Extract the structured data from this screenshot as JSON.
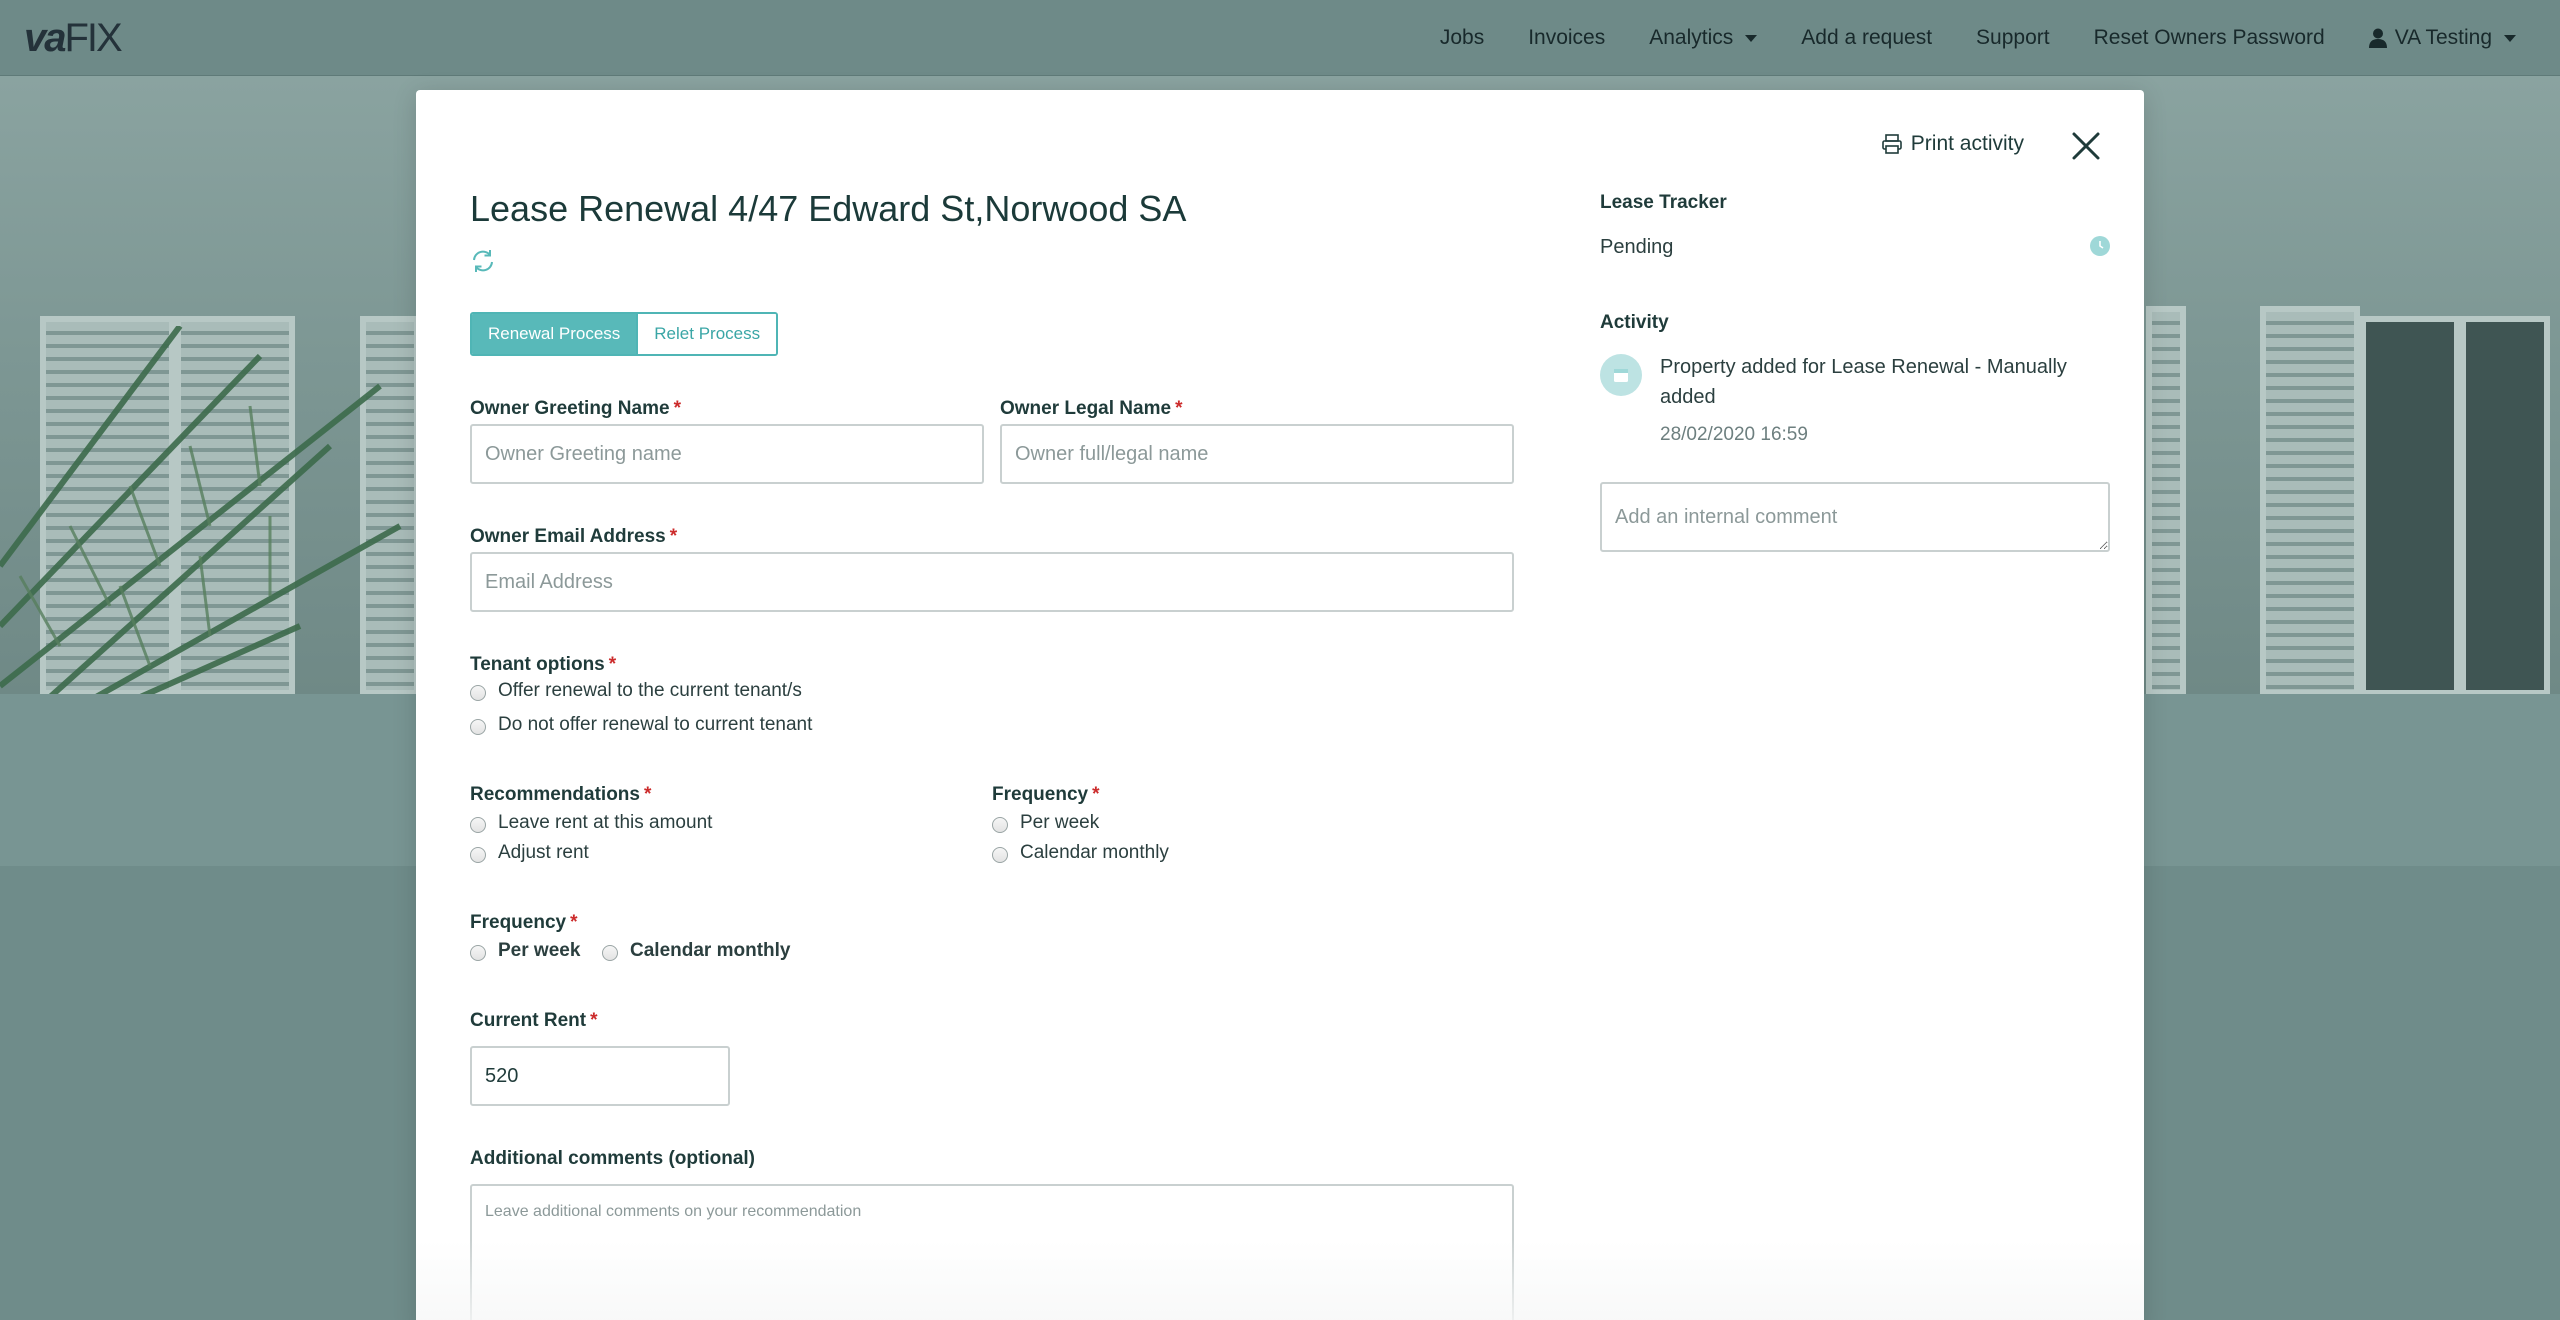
{
  "navbar": {
    "logo_va": "va",
    "logo_fix": "FIX",
    "items": [
      {
        "label": "Jobs"
      },
      {
        "label": "Invoices"
      },
      {
        "label": "Analytics"
      },
      {
        "label": "Add a request"
      },
      {
        "label": "Support"
      },
      {
        "label": "Reset Owners Password"
      },
      {
        "label": "VA Testing"
      }
    ]
  },
  "modal": {
    "print_label": "Print activity",
    "title": "Lease Renewal 4/47 Edward St,Norwood SA",
    "tabs": [
      {
        "label": "Renewal Process",
        "active": true
      },
      {
        "label": "Relet Process",
        "active": false
      }
    ],
    "form": {
      "owner_greeting": {
        "label": "Owner Greeting Name",
        "placeholder": "Owner Greeting name",
        "value": ""
      },
      "owner_legal": {
        "label": "Owner Legal Name",
        "placeholder": "Owner full/legal name",
        "value": ""
      },
      "owner_email": {
        "label": "Owner Email Address",
        "placeholder": "Email Address",
        "value": ""
      },
      "tenant_options": {
        "label": "Tenant options",
        "options": [
          "Offer renewal to the current tenant/s",
          "Do not offer renewal to current tenant"
        ]
      },
      "recommendations": {
        "label": "Recommendations",
        "options": [
          "Leave rent at this amount",
          "Adjust rent"
        ]
      },
      "frequency_right": {
        "label": "Frequency",
        "options": [
          "Per week",
          "Calendar monthly"
        ]
      },
      "frequency": {
        "label": "Frequency",
        "options": [
          "Per week",
          "Calendar monthly"
        ]
      },
      "current_rent": {
        "label": "Current Rent",
        "value": "520"
      },
      "additional_comments": {
        "label": "Additional comments (optional)",
        "placeholder": "Leave additional comments on your recommendation"
      },
      "required_mark": "*"
    },
    "sidebar": {
      "lease_tracker_title": "Lease Tracker",
      "lease_tracker_status": "Pending",
      "activity_title": "Activity",
      "activity_items": [
        {
          "text": "Property added for Lease Renewal - Manually added",
          "timestamp": "28/02/2020 16:59"
        }
      ],
      "comment_placeholder": "Add an internal comment"
    }
  },
  "colors": {
    "accent": "#58b9b9",
    "navbar_bg": "#6e8a88",
    "required": "#cc2b2b"
  }
}
